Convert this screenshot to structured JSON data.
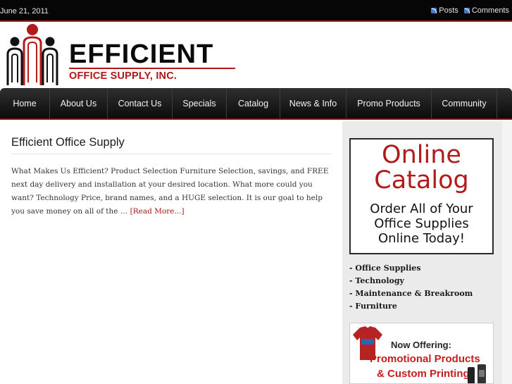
{
  "topbar": {
    "date": "June 21, 2011",
    "feeds": [
      {
        "label": "Posts",
        "icon": "rss-icon"
      },
      {
        "label": "Comments",
        "icon": "rss-icon"
      }
    ]
  },
  "header": {
    "logo_title": "EFFICIENT",
    "logo_subtitle": "OFFICE SUPPLY, INC.",
    "logo_icon": "people-logo-icon"
  },
  "nav": {
    "items": [
      {
        "label": "Home"
      },
      {
        "label": "About Us"
      },
      {
        "label": "Contact Us"
      },
      {
        "label": "Specials"
      },
      {
        "label": "Catalog"
      },
      {
        "label": "News & Info"
      },
      {
        "label": "Promo Products"
      },
      {
        "label": "Community"
      }
    ]
  },
  "post": {
    "title": "Efficient Office Supply",
    "body": "What Makes Us Efficient? Product Selection Furniture Selection, savings, and FREE next day delivery and installation at your desired location. What more could you want? Technology Price, brand names, and a HUGE selection. It is our goal to help you save money on all of the … ",
    "read_more": "[Read More...]"
  },
  "sidebar": {
    "catalog_banner": {
      "line1": "Online",
      "line2": "Catalog",
      "line3": "Order All of Your",
      "line4": "Office Supplies",
      "line5": "Online Today!"
    },
    "links": [
      {
        "label": "- Office Supplies"
      },
      {
        "label": "- Technology"
      },
      {
        "label": "- Maintenance & Breakroom"
      },
      {
        "label": "- Furniture"
      }
    ],
    "promo_banner": {
      "line1": "Now Offering:",
      "line2": "Promotional Products",
      "line3": "& Custom Printing"
    }
  },
  "colors": {
    "accent_red": "#b31b1b",
    "nav_dark": "#0c0c0c",
    "topbar": "#060606"
  }
}
